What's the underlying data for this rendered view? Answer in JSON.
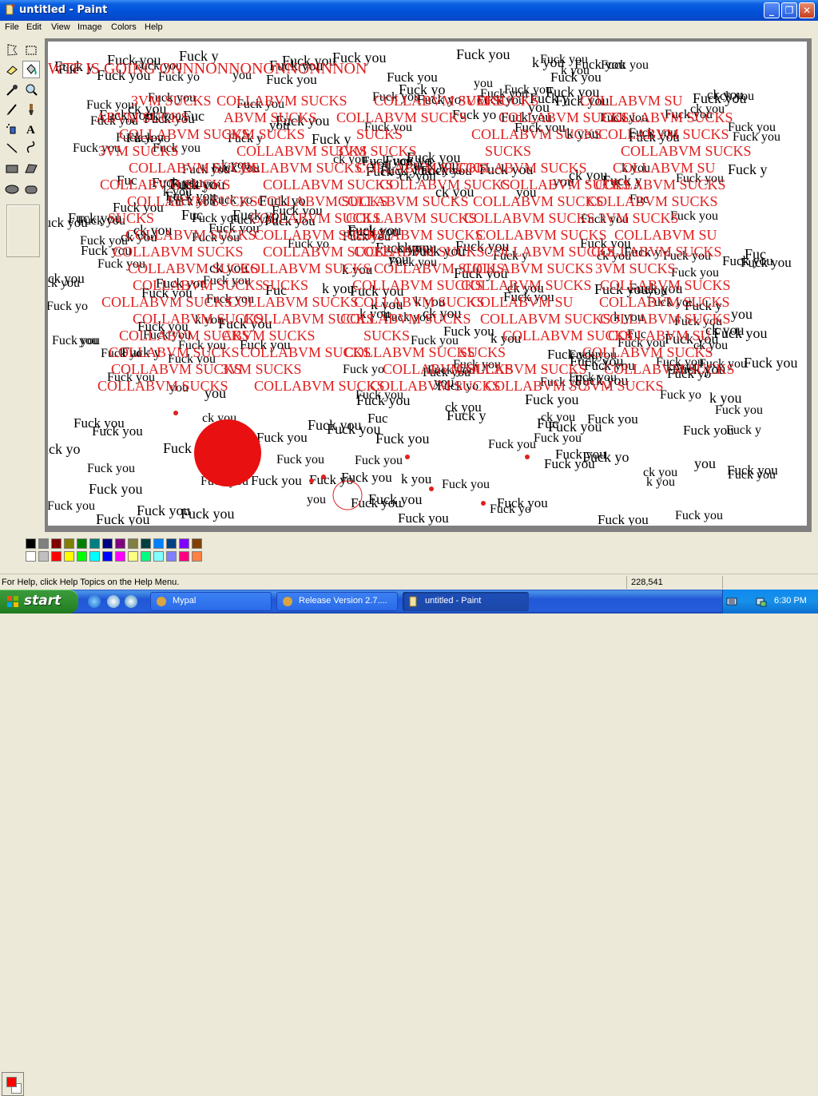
{
  "window": {
    "title": "untitled - Paint"
  },
  "menu": [
    "File",
    "Edit",
    "View",
    "Image",
    "Colors",
    "Help"
  ],
  "tools": [
    {
      "name": "free-form-select-icon"
    },
    {
      "name": "select-icon"
    },
    {
      "name": "eraser-icon"
    },
    {
      "name": "fill-bucket-icon",
      "selected": true
    },
    {
      "name": "pick-color-icon"
    },
    {
      "name": "magnifier-icon"
    },
    {
      "name": "pencil-icon"
    },
    {
      "name": "brush-icon"
    },
    {
      "name": "airbrush-icon"
    },
    {
      "name": "text-icon"
    },
    {
      "name": "line-icon"
    },
    {
      "name": "curve-icon"
    },
    {
      "name": "rectangle-icon"
    },
    {
      "name": "polygon-icon"
    },
    {
      "name": "ellipse-icon"
    },
    {
      "name": "rounded-rectangle-icon"
    }
  ],
  "canvas": {
    "text_top": "WTF IS GOING ONNNONNONONNONNNON",
    "text_red": "COLLABVM SUCKS",
    "text_black": "Fuck you",
    "fragments": [
      "ABVM SUCKS",
      "SUCKS",
      "3VM SUCKS",
      "COLLABVM SU",
      "k you",
      "Fuck y",
      "you",
      "Fuc",
      "ck you",
      "Fuck yo"
    ]
  },
  "colors": {
    "foreground": "#ff0000",
    "background": "#ffffff",
    "palette_top": [
      "#000000",
      "#808080",
      "#800000",
      "#808000",
      "#008000",
      "#008080",
      "#000080",
      "#800080",
      "#808040",
      "#004040",
      "#0080ff",
      "#004080",
      "#8000ff",
      "#804000"
    ],
    "palette_bottom": [
      "#ffffff",
      "#c0c0c0",
      "#ff0000",
      "#ffff00",
      "#00ff00",
      "#00ffff",
      "#0000ff",
      "#ff00ff",
      "#ffff80",
      "#00ff80",
      "#80ffff",
      "#8080ff",
      "#ff0080",
      "#ff8040"
    ]
  },
  "status": {
    "help": "For Help, click Help Topics on the Help Menu.",
    "coords": "228,541"
  },
  "taskbar": {
    "start": "start",
    "tasks": [
      "Mypal",
      "Release Version 2.7....",
      "untitled - Paint"
    ],
    "clock": "6:30 PM"
  }
}
